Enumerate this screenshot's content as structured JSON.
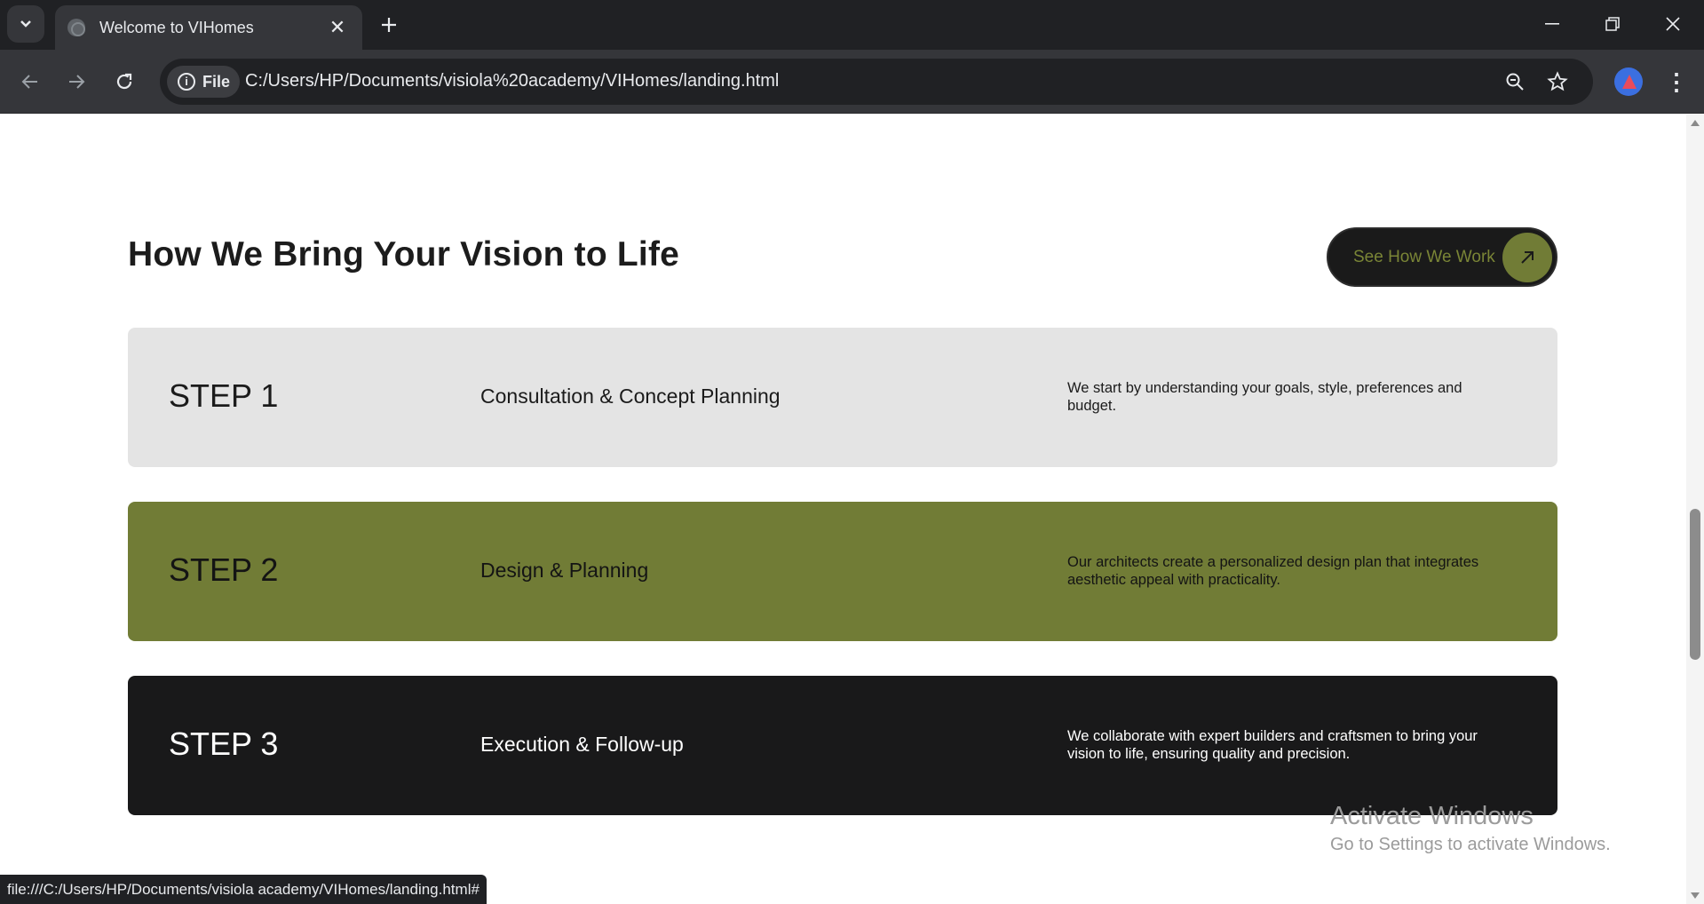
{
  "browser": {
    "tab_title": "Welcome to VIHomes",
    "address_chip": "File",
    "url": "C:/Users/HP/Documents/visiola%20academy/VIHomes/landing.html",
    "status_url": "file:///C:/Users/HP/Documents/visiola academy/VIHomes/landing.html#"
  },
  "section": {
    "title": "How We Bring Your Vision to Life",
    "cta_label": "See How We Work"
  },
  "steps": [
    {
      "number": "STEP 1",
      "name": "Consultation & Concept Planning",
      "description": "We start by understanding your goals, style, preferences and budget."
    },
    {
      "number": "STEP 2",
      "name": "Design & Planning",
      "description": "Our architects create a personalized design plan that integrates aesthetic appeal with practicality."
    },
    {
      "number": "STEP 3",
      "name": "Execution & Follow-up",
      "description": "We collaborate with expert builders and craftsmen to bring your vision to life, ensuring quality and precision."
    }
  ],
  "watermark": {
    "line1": "Activate Windows",
    "line2": "Go to Settings to activate Windows."
  },
  "colors": {
    "olive_accent": "#717c36",
    "dark": "#19191a",
    "light_gray": "#e4e4e4"
  },
  "icons": [
    "tab-search-icon",
    "globe-icon",
    "close-icon",
    "plus-icon",
    "minimize-icon",
    "restore-icon",
    "window-close-icon",
    "back-arrow-icon",
    "forward-arrow-icon",
    "reload-icon",
    "info-icon",
    "zoom-icon",
    "star-icon",
    "profile-avatar",
    "kebab-menu-icon",
    "arrow-up-right-icon"
  ]
}
